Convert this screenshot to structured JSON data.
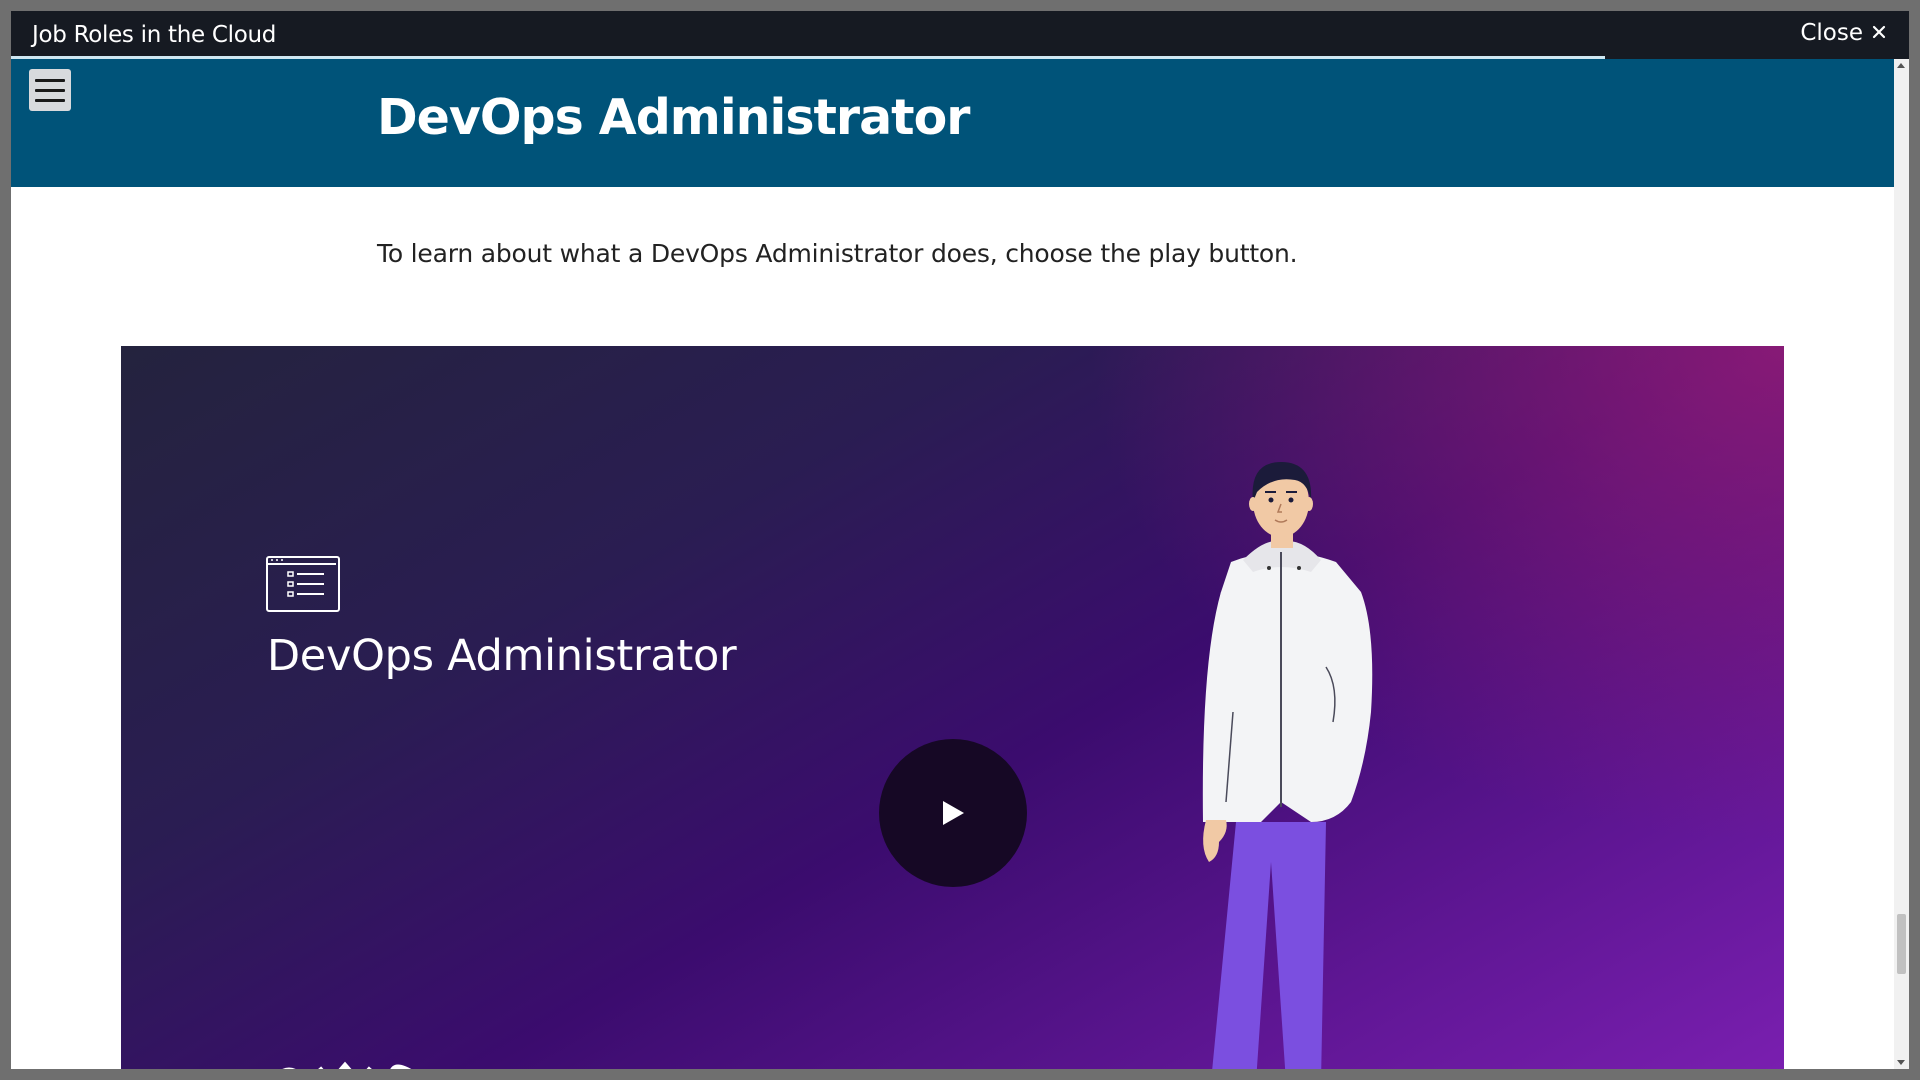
{
  "window": {
    "title": "Job Roles in the Cloud",
    "close_label": "Close",
    "close_icon": "close-icon",
    "progress_percent": 84
  },
  "header": {
    "menu_icon": "hamburger-menu-icon",
    "title": "DevOps Administrator",
    "background": "#005379"
  },
  "main": {
    "instruction": "To learn about what a DevOps Administrator does, choose the play button."
  },
  "video": {
    "title": "DevOps Administrator",
    "play_icon": "play-icon",
    "logo_icon": "aws-logo"
  }
}
